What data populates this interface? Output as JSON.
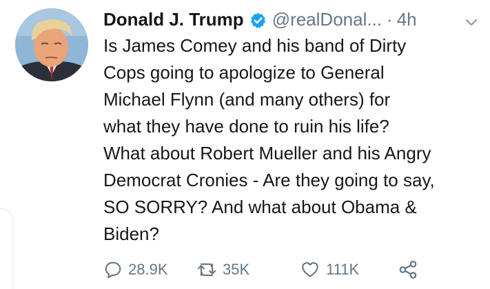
{
  "author": {
    "name": "Donald J. Trump",
    "handle": "@realDonal...",
    "separator": "·",
    "time": "4h"
  },
  "tweet": {
    "lines": [
      "Is James Comey and his band of Dirty",
      "Cops going to apologize to General",
      "Michael Flynn (and many others) for",
      "what they have done to ruin his life?",
      "What about Robert Mueller and his Angry",
      "Democrat Cronies - Are they going to say,",
      "SO SORRY? And what about Obama &",
      "Biden?"
    ]
  },
  "actions": {
    "reply_count": "28.9K",
    "retweet_count": "35K",
    "like_count": "111K"
  },
  "icons": {
    "verified": "verified-badge-icon",
    "menu": "chevron-down-icon",
    "reply": "reply-icon",
    "retweet": "retweet-icon",
    "like": "heart-icon",
    "share": "share-icon"
  },
  "colors": {
    "verified": "#1da1f2",
    "secondary_text": "#657786",
    "primary_text": "#14171a"
  }
}
